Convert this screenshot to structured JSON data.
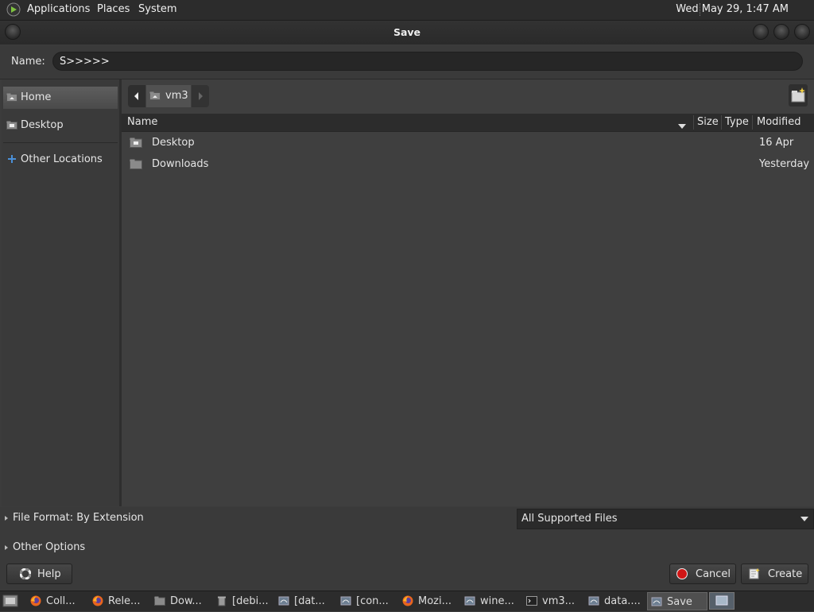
{
  "top_panel": {
    "menus": [
      "Applications",
      "Places",
      "System"
    ],
    "clock": "Wed May 29,  1:47 AM"
  },
  "dialog": {
    "title": "Save",
    "name_label": "Name:",
    "name_value": "S>>>>>"
  },
  "sidebar": {
    "items": [
      {
        "label": "Home",
        "icon": "home-folder-icon",
        "selected": true
      },
      {
        "label": "Desktop",
        "icon": "desktop-folder-icon",
        "selected": false
      },
      {
        "label": "Other Locations",
        "icon": "plus-icon",
        "selected": false
      }
    ]
  },
  "pathbar": {
    "current": "vm3"
  },
  "file_list": {
    "columns": [
      "Name",
      "Size",
      "Type",
      "Modified"
    ],
    "rows": [
      {
        "name": "Desktop",
        "size": "",
        "type": "",
        "modified": "16 Apr",
        "icon": "desktop-folder-icon"
      },
      {
        "name": "Downloads",
        "size": "",
        "type": "",
        "modified": "Yesterday",
        "icon": "folder-icon"
      }
    ]
  },
  "options": {
    "file_format": "File Format: By Extension",
    "other_options": "Other Options",
    "filter_value": "All Supported Files"
  },
  "buttons": {
    "help": "Help",
    "cancel": "Cancel",
    "create": "Create"
  },
  "taskbar": {
    "items": [
      {
        "label": "Coll...",
        "icon": "firefox-icon"
      },
      {
        "label": "Rele...",
        "icon": "firefox-icon"
      },
      {
        "label": "Dow...",
        "icon": "folder-icon"
      },
      {
        "label": "[debi...",
        "icon": "trash-icon"
      },
      {
        "label": "[dat...",
        "icon": "app-icon"
      },
      {
        "label": "[con...",
        "icon": "app-icon"
      },
      {
        "label": "Mozi...",
        "icon": "firefox-icon"
      },
      {
        "label": "wine...",
        "icon": "app-icon"
      },
      {
        "label": "vm3...",
        "icon": "terminal-icon"
      },
      {
        "label": "data....",
        "icon": "app-icon"
      },
      {
        "label": "Save",
        "icon": "app-icon",
        "active": true
      }
    ]
  },
  "colors": {
    "panel_bg": "#2c2c2c",
    "window_bg": "#3c3c3c",
    "selection": "#5a5a5a",
    "accent_blue": "#4a90d9",
    "cancel_red": "#d01515"
  }
}
